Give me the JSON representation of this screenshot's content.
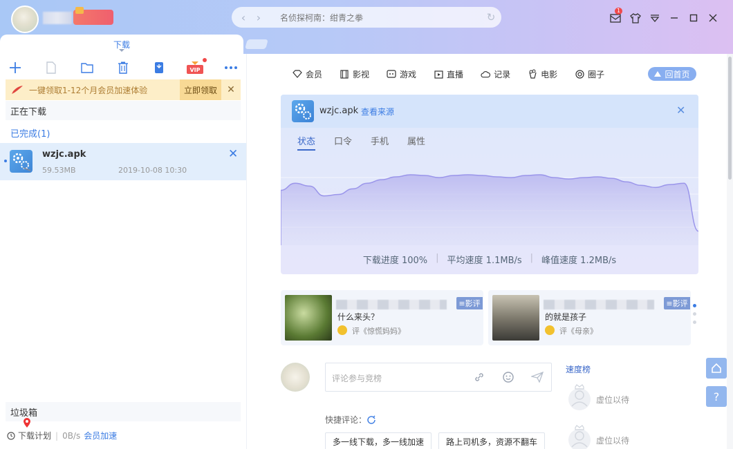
{
  "search": {
    "title": "名侦探柯南：绀青之拳"
  },
  "window": {
    "mail_badge": "1"
  },
  "left_panel": {
    "tab_label": "下载",
    "promo": {
      "text": "一键领取1-12个月会员加速体验",
      "claim": "立即领取",
      "close": "✕"
    },
    "downloading_label": "正在下载",
    "completed_label": "已完成(1)",
    "items": [
      {
        "name": "wzjc.apk",
        "size": "59.53MB",
        "date": "2019-10-08 10:30"
      }
    ],
    "trash_label": "垃圾箱",
    "bottom": {
      "plan": "下载计划",
      "speed": "0B/s",
      "vip": "会员加速"
    }
  },
  "nav": {
    "items": [
      "会员",
      "影视",
      "游戏",
      "直播",
      "记录",
      "电影",
      "圈子"
    ],
    "home": "回首页"
  },
  "task_panel": {
    "file_name": "wzjc.apk",
    "source_link": "查看来源",
    "tabs": [
      "状态",
      "口令",
      "手机",
      "属性"
    ],
    "active_tab": 0,
    "stats": {
      "progress": "下载进度 100%",
      "avg_speed": "平均速度 1.1MB/s",
      "peak_speed": "峰值速度 1.2MB/s"
    }
  },
  "speed_curve": [
    0.78,
    0.88,
    0.84,
    0.7,
    0.72,
    0.8,
    0.88,
    0.93,
    0.97,
    1.0,
    0.99,
    0.96,
    0.99,
    1.0,
    0.99,
    0.97,
    0.96,
    0.99,
    1.0,
    0.96,
    0.94,
    0.96,
    0.97,
    0.95,
    0.9,
    0.85,
    0.82,
    0.86,
    0.88,
    0.2
  ],
  "cards": [
    {
      "tag": "影评",
      "title": "什么来头？",
      "ref": "评《惊慌妈妈》"
    },
    {
      "tag": "影评",
      "title": "的就是孩子",
      "ref": "评《母亲》"
    }
  ],
  "comment": {
    "placeholder": "评论参与竞榜",
    "quick_label": "快捷评论：",
    "quick_buttons": [
      "多一线下载，多一线加速",
      "路上司机多，资源不翻车"
    ]
  },
  "ranking": {
    "title": "速度榜",
    "slots": [
      "虚位以待",
      "虚位以待"
    ]
  },
  "colors": {
    "accent": "#3b7ce3",
    "promo_bg": "#fdeec8",
    "curve": "#9a95ea"
  }
}
